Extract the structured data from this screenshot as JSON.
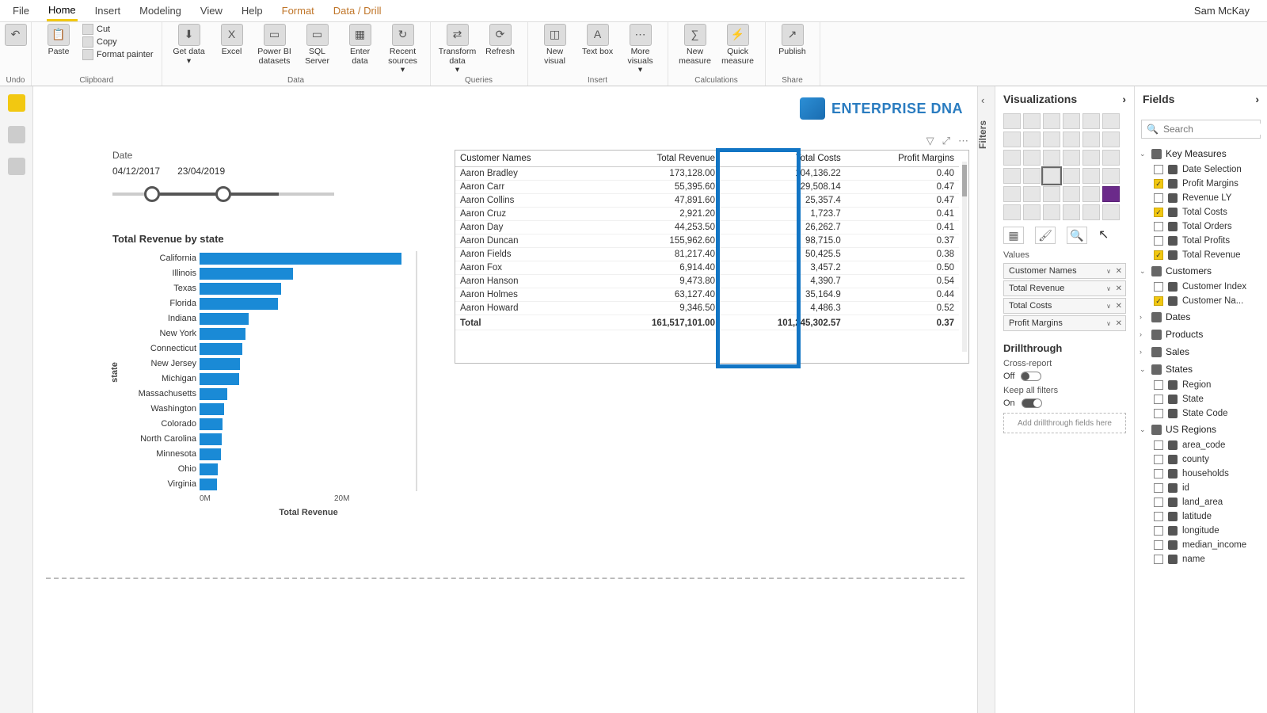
{
  "user": "Sam McKay",
  "tabs": [
    "File",
    "Home",
    "Insert",
    "Modeling",
    "View",
    "Help",
    "Format",
    "Data / Drill"
  ],
  "active_tab": "Home",
  "ribbon": {
    "clipboard": {
      "paste": "Paste",
      "cut": "Cut",
      "copy": "Copy",
      "format_painter": "Format painter",
      "label": "Clipboard"
    },
    "undo": {
      "label": "Undo"
    },
    "data": {
      "get": "Get data",
      "excel": "Excel",
      "pbi": "Power BI datasets",
      "sql": "SQL Server",
      "enter": "Enter data",
      "recent": "Recent sources",
      "label": "Data"
    },
    "queries": {
      "transform": "Transform data",
      "refresh": "Refresh",
      "label": "Queries"
    },
    "insert": {
      "newv": "New visual",
      "text": "Text box",
      "more": "More visuals",
      "label": "Insert"
    },
    "calc": {
      "newm": "New measure",
      "quick": "Quick measure",
      "label": "Calculations"
    },
    "share": {
      "publish": "Publish",
      "label": "Share"
    }
  },
  "logo_text": "ENTERPRISE DNA",
  "slicer": {
    "title": "Date",
    "from": "04/12/2017",
    "to": "23/04/2019"
  },
  "chart_data": {
    "type": "bar",
    "title": "Total Revenue by state",
    "ylabel": "state",
    "xlabel": "Total Revenue",
    "xticks": [
      "0M",
      "20M"
    ],
    "xtick_values": [
      0,
      20000000
    ],
    "xlim": [
      0,
      27000000
    ],
    "categories": [
      "California",
      "Illinois",
      "Texas",
      "Florida",
      "Indiana",
      "New York",
      "Connecticut",
      "New Jersey",
      "Michigan",
      "Massachusetts",
      "Washington",
      "Colorado",
      "North Carolina",
      "Minnesota",
      "Ohio",
      "Virginia"
    ],
    "values": [
      26500000,
      12300000,
      10700000,
      10300000,
      6400000,
      6000000,
      5600000,
      5300000,
      5200000,
      3600000,
      3200000,
      3000000,
      2900000,
      2800000,
      2400000,
      2300000
    ]
  },
  "table": {
    "columns": [
      "Customer Names",
      "Total Revenue",
      "Total Costs",
      "Profit Margins"
    ],
    "rows": [
      {
        "name": "Aaron Bradley",
        "rev": "173,128.00",
        "cost": "104,136.22",
        "pm": "0.40"
      },
      {
        "name": "Aaron Carr",
        "rev": "55,395.60",
        "cost": "29,508.14",
        "pm": "0.47"
      },
      {
        "name": "Aaron Collins",
        "rev": "47,891.60",
        "cost": "25,357.4",
        "pm": "0.47"
      },
      {
        "name": "Aaron Cruz",
        "rev": "2,921.20",
        "cost": "1,723.7",
        "pm": "0.41"
      },
      {
        "name": "Aaron Day",
        "rev": "44,253.50",
        "cost": "26,262.7",
        "pm": "0.41"
      },
      {
        "name": "Aaron Duncan",
        "rev": "155,962.60",
        "cost": "98,715.0",
        "pm": "0.37"
      },
      {
        "name": "Aaron Fields",
        "rev": "81,217.40",
        "cost": "50,425.5",
        "pm": "0.38"
      },
      {
        "name": "Aaron Fox",
        "rev": "6,914.40",
        "cost": "3,457.2",
        "pm": "0.50"
      },
      {
        "name": "Aaron Hanson",
        "rev": "9,473.80",
        "cost": "4,390.7",
        "pm": "0.54"
      },
      {
        "name": "Aaron Holmes",
        "rev": "63,127.40",
        "cost": "35,164.9",
        "pm": "0.44"
      },
      {
        "name": "Aaron Howard",
        "rev": "9,346.50",
        "cost": "4,486.3",
        "pm": "0.52"
      }
    ],
    "total": {
      "label": "Total",
      "rev": "161,517,101.00",
      "cost": "101,245,302.57",
      "pm": "0.37"
    }
  },
  "filters_label": "Filters",
  "viz": {
    "header": "Visualizations",
    "values_label": "Values",
    "wells": [
      "Customer Names",
      "Total Revenue",
      "Total Costs",
      "Profit Margins"
    ],
    "drill_header": "Drillthrough",
    "cross": "Cross-report",
    "cross_state": "Off",
    "keep": "Keep all filters",
    "keep_state": "On",
    "drill_placeholder": "Add drillthrough fields here"
  },
  "fields": {
    "header": "Fields",
    "search_placeholder": "Search",
    "tables": [
      {
        "name": "Key Measures",
        "expanded": true,
        "fields": [
          {
            "name": "Date Selection",
            "checked": false,
            "calc": true
          },
          {
            "name": "Profit Margins",
            "checked": true,
            "calc": true
          },
          {
            "name": "Revenue LY",
            "checked": false,
            "calc": true
          },
          {
            "name": "Total Costs",
            "checked": true,
            "calc": true
          },
          {
            "name": "Total Orders",
            "checked": false,
            "calc": true
          },
          {
            "name": "Total Profits",
            "checked": false,
            "calc": true
          },
          {
            "name": "Total Revenue",
            "checked": true,
            "calc": true
          }
        ]
      },
      {
        "name": "Customers",
        "expanded": true,
        "fields": [
          {
            "name": "Customer Index",
            "checked": false
          },
          {
            "name": "Customer Na...",
            "checked": true
          }
        ]
      },
      {
        "name": "Dates",
        "expanded": false
      },
      {
        "name": "Products",
        "expanded": false
      },
      {
        "name": "Sales",
        "expanded": false
      },
      {
        "name": "States",
        "expanded": true,
        "fields": [
          {
            "name": "Region",
            "checked": false
          },
          {
            "name": "State",
            "checked": false
          },
          {
            "name": "State Code",
            "checked": false
          }
        ]
      },
      {
        "name": "US Regions",
        "expanded": true,
        "fields": [
          {
            "name": "area_code",
            "checked": false
          },
          {
            "name": "county",
            "checked": false
          },
          {
            "name": "households",
            "checked": false
          },
          {
            "name": "id",
            "checked": false
          },
          {
            "name": "land_area",
            "checked": false
          },
          {
            "name": "latitude",
            "checked": false
          },
          {
            "name": "longitude",
            "checked": false
          },
          {
            "name": "median_income",
            "checked": false
          },
          {
            "name": "name",
            "checked": false
          }
        ]
      }
    ]
  }
}
